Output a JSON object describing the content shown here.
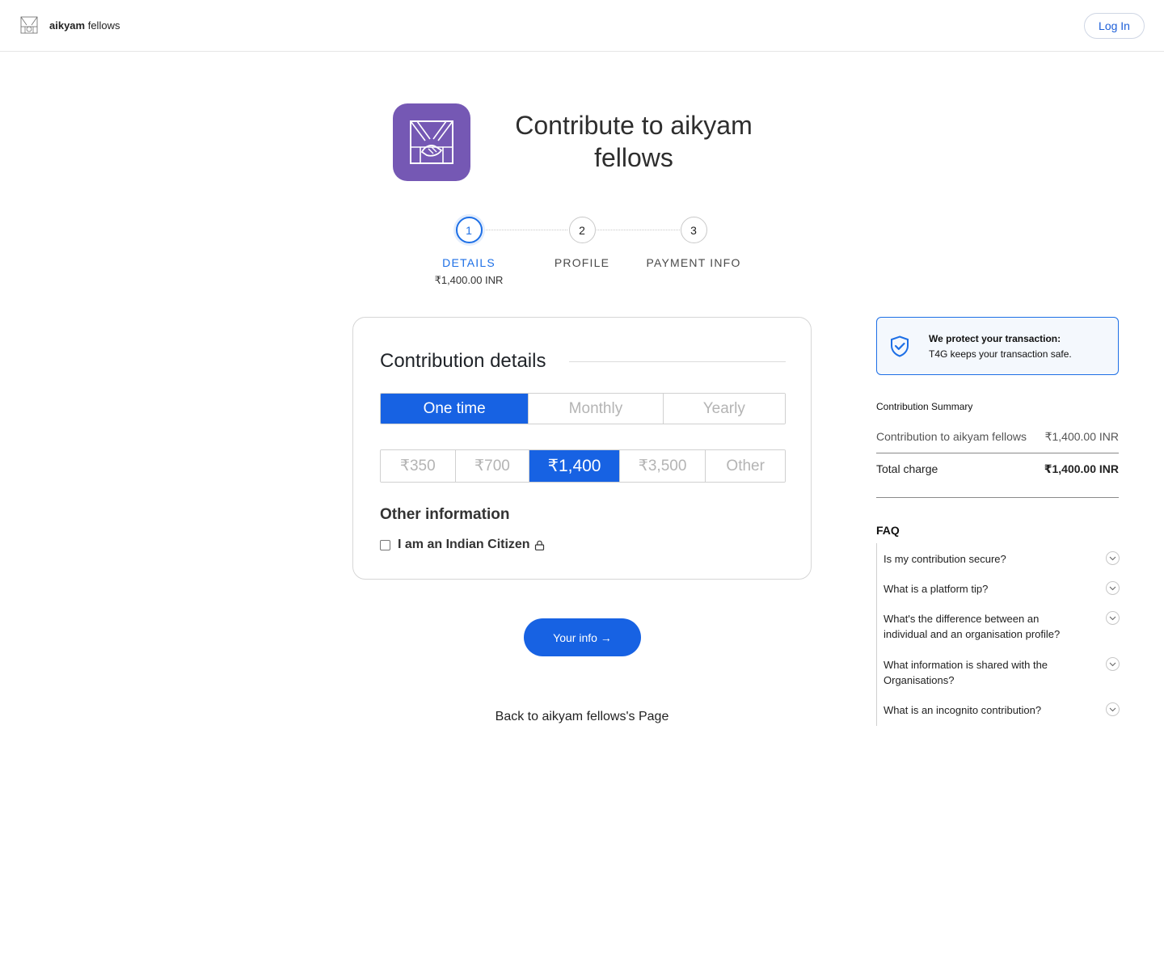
{
  "header": {
    "brand_bold": "aikyam",
    "brand_rest": "fellows",
    "login_label": "Log In"
  },
  "page": {
    "title": "Contribute to aikyam fellows"
  },
  "stepper": {
    "steps": [
      {
        "number": "1",
        "label": "DETAILS",
        "sub": "₹1,400.00 INR",
        "active": true
      },
      {
        "number": "2",
        "label": "PROFILE",
        "active": false
      },
      {
        "number": "3",
        "label": "PAYMENT INFO",
        "active": false
      }
    ]
  },
  "contribution": {
    "title": "Contribution details",
    "frequency": [
      {
        "label": "One time",
        "selected": true
      },
      {
        "label": "Monthly",
        "selected": false
      },
      {
        "label": "Yearly",
        "selected": false
      }
    ],
    "amounts": [
      {
        "label": "₹350",
        "selected": false
      },
      {
        "label": "₹700",
        "selected": false
      },
      {
        "label": "₹1,400",
        "selected": true
      },
      {
        "label": "₹3,500",
        "selected": false
      },
      {
        "label": "Other",
        "selected": false
      }
    ],
    "other_info_title": "Other information",
    "citizen_label": "I am an Indian Citizen",
    "citizen_checked": false
  },
  "actions": {
    "next_label": "Your info →",
    "back_label": "Back to aikyam fellows's Page"
  },
  "protection": {
    "title": "We protect your transaction:",
    "subtitle": "T4G keeps your transaction safe."
  },
  "summary": {
    "title": "Contribution Summary",
    "line_label": "Contribution to aikyam fellows",
    "line_value": "₹1,400.00 INR",
    "total_label": "Total charge",
    "total_value": "₹1,400.00 INR"
  },
  "faq": {
    "title": "FAQ",
    "items": [
      "Is my contribution secure?",
      "What is a platform tip?",
      "What's the difference between an individual and an organisation profile?",
      "What information is shared with the Organisations?",
      "What is an incognito contribution?"
    ]
  },
  "colors": {
    "primary": "#1762e3",
    "accent_blue": "#1d6fe6",
    "org_logo_bg": "#7558b4"
  }
}
